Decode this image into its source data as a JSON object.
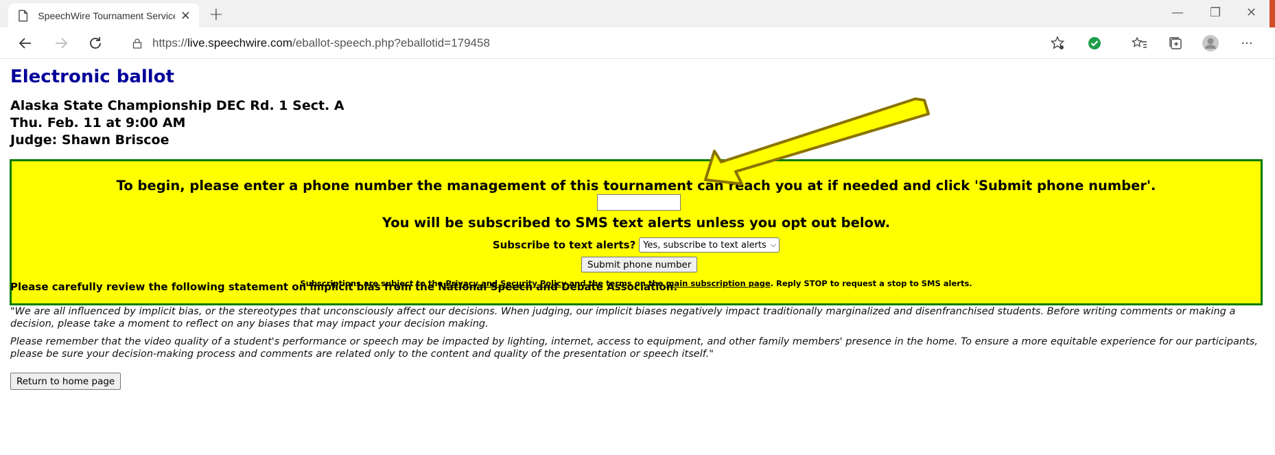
{
  "browser": {
    "tab_title": "SpeechWire Tournament Service",
    "tab_close": "×",
    "new_tab": "+",
    "url_scheme": "https://",
    "url_host": "live.speechwire.com",
    "url_path": "/eballot-speech.php?eballotid=179458",
    "window_minimize": "—",
    "window_restore": "❐",
    "window_close": "✕",
    "more": "···"
  },
  "page": {
    "title": "Electronic ballot",
    "tournament": "Alaska State Championship DEC Rd. 1 Sect. A",
    "datetime": "Thu. Feb. 11 at 9:00 AM",
    "judge": "Judge: Shawn Briscoe"
  },
  "alert": {
    "begin_text": "To begin, please enter a phone number the management of this tournament can reach you at if needed and click 'Submit phone number'.",
    "phone_value": "",
    "optout_text": "You will be subscribed to SMS text alerts unless you opt out below.",
    "subscribe_label": "Subscribe to text alerts?",
    "subscribe_selected": "Yes, subscribe to text alerts",
    "submit_label": "Submit phone number",
    "fine_pre": "Subscriptions are subject to the ",
    "privacy_link": "Privacy and Security Policy",
    "fine_mid": " and the terms on the ",
    "subscription_link": "main subscription page",
    "fine_post": ". Reply STOP to request a stop to SMS alerts."
  },
  "bias": {
    "heading": "Please carefully review the following statement on implicit bias from the National Speech and Debate Association.",
    "para1": "\"We are all influenced by implicit bias, or the stereotypes that unconsciously affect our decisions. When judging, our implicit biases negatively impact traditionally marginalized and disenfranchised students. Before writing comments or making a decision, please take a moment to reflect on any biases that may impact your decision making.",
    "para2": "Please remember that the video quality of a student's performance or speech may be impacted by lighting, internet, access to equipment, and other family members' presence in the home. To ensure a more equitable experience for our participants, please be sure your decision-making process and comments are related only to the content and quality of the presentation or speech itself.\""
  },
  "footer": {
    "home_button": "Return to home page"
  },
  "colors": {
    "title": "#000099",
    "alert_bg": "#ffff00",
    "alert_border": "#007a00",
    "arrow_fill": "#ffff00",
    "arrow_stroke": "#8a7300"
  }
}
